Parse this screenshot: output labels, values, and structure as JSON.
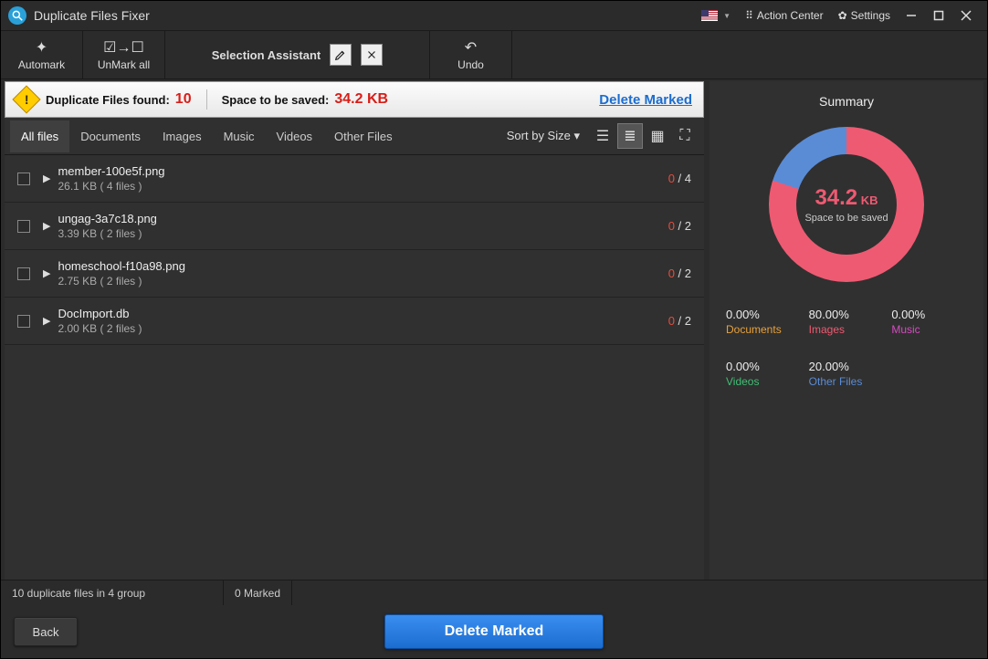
{
  "title": "Duplicate Files Fixer",
  "titlebar": {
    "action_center": "Action Center",
    "settings": "Settings"
  },
  "toolbar": {
    "automark": "Automark",
    "unmark_all": "UnMark all",
    "selection_assistant": "Selection Assistant",
    "undo": "Undo"
  },
  "infobar": {
    "found_label": "Duplicate Files found:",
    "found_count": "10",
    "space_label": "Space to be saved:",
    "space_value": "34.2 KB",
    "delete_marked": "Delete Marked"
  },
  "tabs": {
    "all": "All files",
    "documents": "Documents",
    "images": "Images",
    "music": "Music",
    "videos": "Videos",
    "other": "Other Files",
    "sort": "Sort by Size ▾"
  },
  "files": [
    {
      "name": "member-100e5f.png",
      "sub": "26.1 KB ( 4 files )",
      "sel": "0",
      "tot": "4"
    },
    {
      "name": "ungag-3a7c18.png",
      "sub": "3.39 KB ( 2 files )",
      "sel": "0",
      "tot": "2"
    },
    {
      "name": "homeschool-f10a98.png",
      "sub": "2.75 KB ( 2 files )",
      "sel": "0",
      "tot": "2"
    },
    {
      "name": "DocImport.db",
      "sub": "2.00 KB ( 2 files )",
      "sel": "0",
      "tot": "2"
    }
  ],
  "summary": {
    "title": "Summary",
    "big_value": "34.2",
    "big_unit": " KB",
    "sub": "Space to be saved",
    "stats": [
      {
        "pct": "0.00%",
        "label": "Documents",
        "cls": "c-doc"
      },
      {
        "pct": "80.00%",
        "label": "Images",
        "cls": "c-img"
      },
      {
        "pct": "0.00%",
        "label": "Music",
        "cls": "c-mus"
      },
      {
        "pct": "0.00%",
        "label": "Videos",
        "cls": "c-vid"
      },
      {
        "pct": "20.00%",
        "label": "Other Files",
        "cls": "c-oth"
      }
    ]
  },
  "status": {
    "left": "10 duplicate files in 4 group",
    "right": "0 Marked"
  },
  "footer": {
    "back": "Back",
    "delete": "Delete Marked"
  },
  "chart_data": {
    "type": "pie",
    "title": "Space to be saved",
    "categories": [
      "Images",
      "Other Files",
      "Documents",
      "Music",
      "Videos"
    ],
    "values": [
      80.0,
      20.0,
      0.0,
      0.0,
      0.0
    ],
    "colors": [
      "#ee5a72",
      "#5a8cd6",
      "#e8a13a",
      "#d64cc1",
      "#3fbf74"
    ],
    "center_value": "34.2 KB"
  }
}
